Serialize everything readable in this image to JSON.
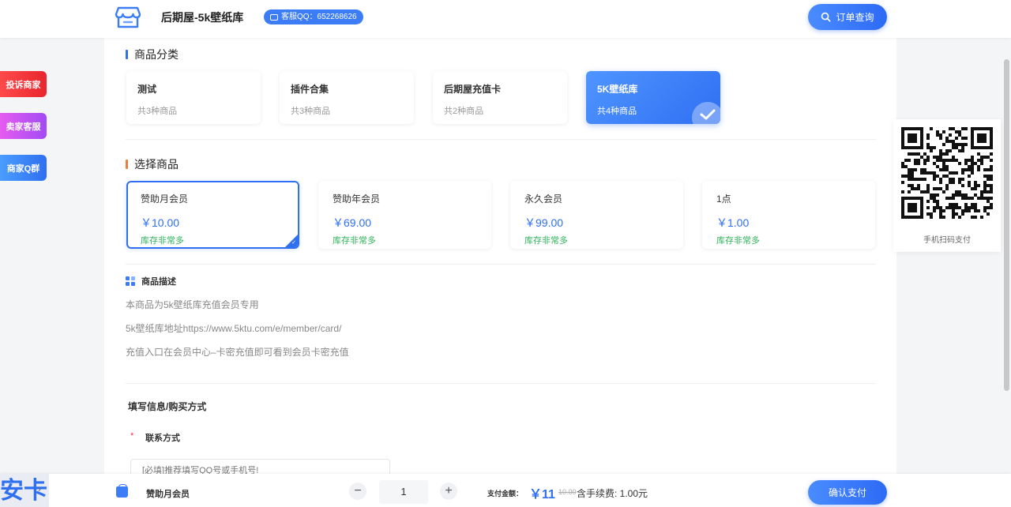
{
  "header": {
    "shop_title": "后期屋-5k壁纸库",
    "qq_badge": "客服QQ：652268626",
    "order_button": "订单查询"
  },
  "side_buttons": {
    "complaint": "投诉商家",
    "service": "卖家客服",
    "group": "商家Q群"
  },
  "categories": {
    "title": "商品分类",
    "items": [
      {
        "name": "测试",
        "count": "共3种商品"
      },
      {
        "name": "插件合集",
        "count": "共3种商品"
      },
      {
        "name": "后期屋充值卡",
        "count": "共2种商品"
      },
      {
        "name": "5K壁纸库",
        "count": "共4种商品"
      }
    ]
  },
  "goods": {
    "title": "选择商品",
    "items": [
      {
        "name": "赞助月会员",
        "price": "￥10.00",
        "stock": "库存非常多"
      },
      {
        "name": "赞助年会员",
        "price": "￥69.00",
        "stock": "库存非常多"
      },
      {
        "name": "永久会员",
        "price": "￥99.00",
        "stock": "库存非常多"
      },
      {
        "name": "1点",
        "price": "￥1.00",
        "stock": "库存非常多"
      }
    ]
  },
  "description": {
    "title": "商品描述",
    "lines": [
      "本商品为5k壁纸库充值会员专用",
      "5k壁纸库地址https://www.5ktu.com/e/member/card/",
      "充值入口在会员中心–卡密充值即可看到会员卡密充值"
    ]
  },
  "form": {
    "title": "填写信息/购买方式",
    "required_mark": "*",
    "contact_label": "联系方式",
    "contact_placeholder": "[必填]推荐填写QQ号或手机号!"
  },
  "qr": {
    "label": "手机扫码支付"
  },
  "bottom": {
    "corner_text": "安卡",
    "product_name": "赞助月会员",
    "minus": "−",
    "quantity": "1",
    "plus": "+",
    "pay_label": "支付金额：",
    "pay_amount": "￥11",
    "original_price": "10.00",
    "fee_text": "含手续费: 1.00元",
    "confirm_button": "确认支付"
  },
  "colors": {
    "accent": "#2f6ff2",
    "stock_green": "#2fb35a",
    "complaint_red": "#e8262e",
    "service_purple": "#a24bf5"
  }
}
